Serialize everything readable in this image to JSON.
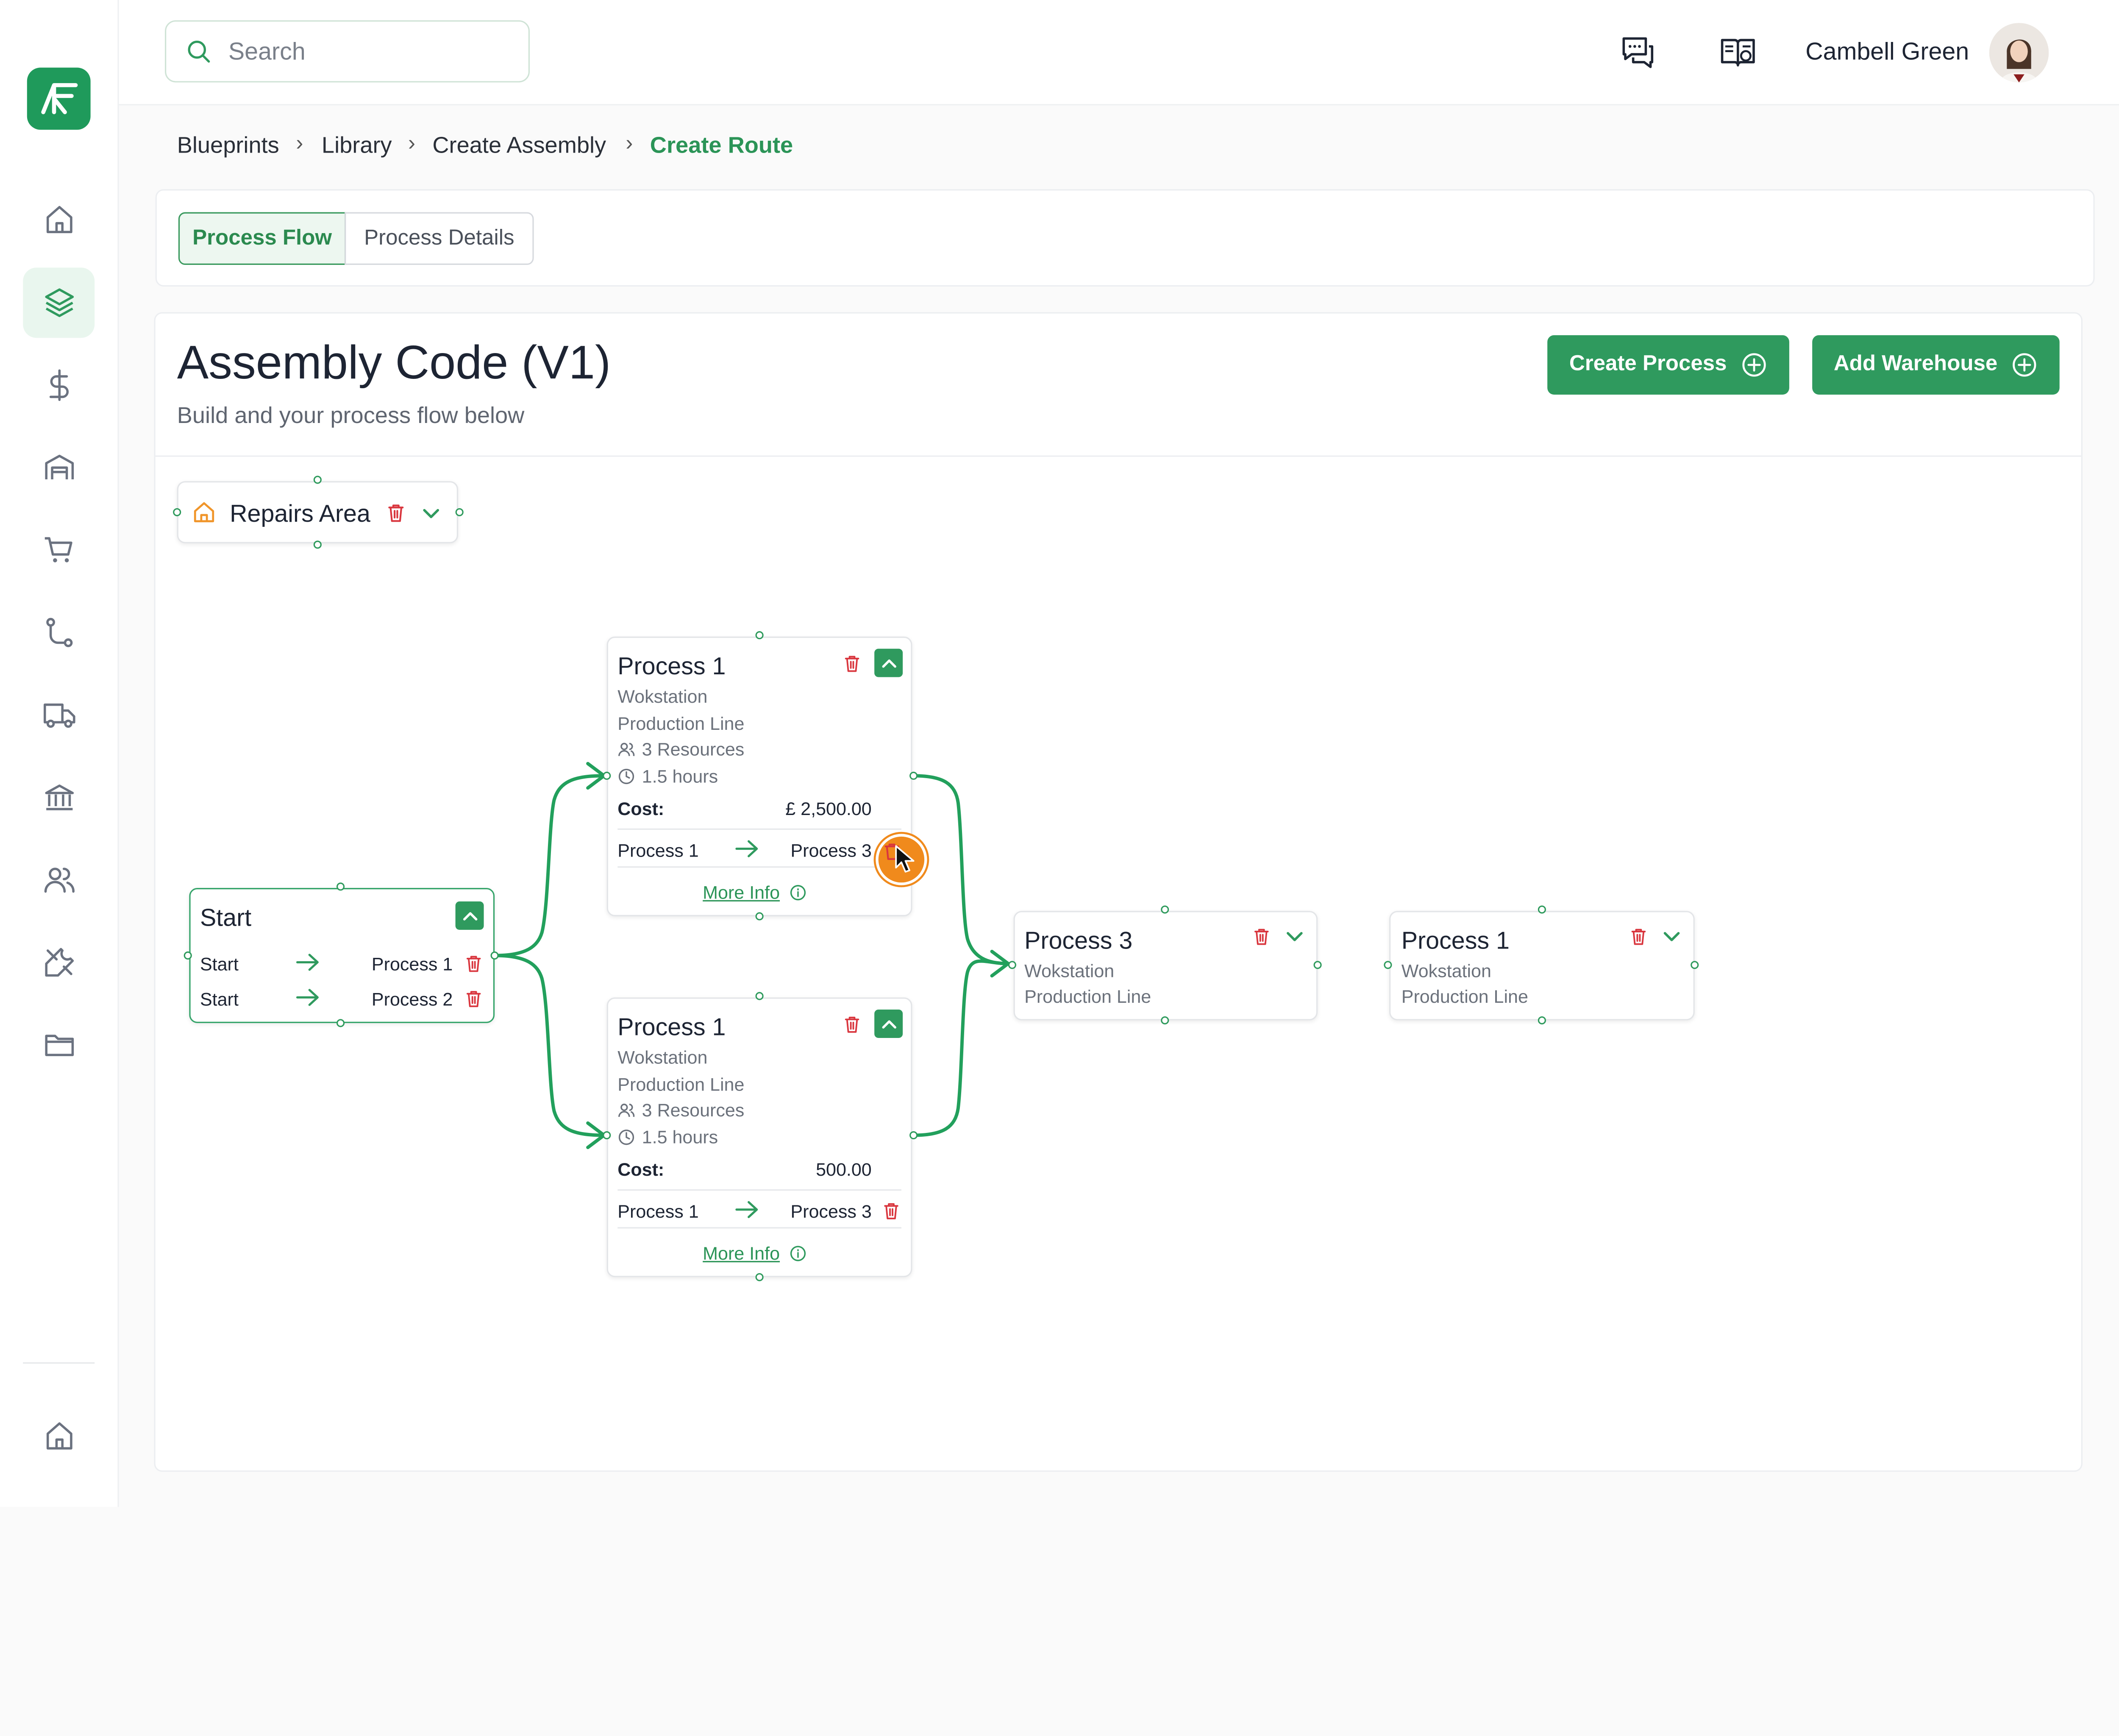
{
  "app": {
    "logo_text": "AF",
    "user_name": "Cambell Green"
  },
  "search": {
    "placeholder": "Search",
    "value": ""
  },
  "sidebar": {
    "items": [
      {
        "icon": "home-icon",
        "active": false
      },
      {
        "icon": "layers-icon",
        "active": true
      },
      {
        "icon": "dollar-icon",
        "active": false
      },
      {
        "icon": "warehouse-icon",
        "active": false
      },
      {
        "icon": "cart-icon",
        "active": false
      },
      {
        "icon": "route-icon",
        "active": false
      },
      {
        "icon": "truck-icon",
        "active": false
      },
      {
        "icon": "bank-icon",
        "active": false
      },
      {
        "icon": "users-icon",
        "active": false
      },
      {
        "icon": "tools-icon",
        "active": false
      },
      {
        "icon": "folder-icon",
        "active": false
      }
    ],
    "bottom_item": {
      "icon": "home-icon"
    }
  },
  "breadcrumb": [
    "Blueprints",
    "Library",
    "Create Assembly",
    "Create Route"
  ],
  "tabs": [
    {
      "label": "Process Flow",
      "active": true
    },
    {
      "label": "Process Details",
      "active": false
    }
  ],
  "main": {
    "title": "Assembly Code (V1)",
    "subtitle": "Build and your process flow below",
    "create_process_label": "Create Process",
    "add_warehouse_label": "Add Warehouse"
  },
  "flow": {
    "repairs": {
      "label": "Repairs Area"
    },
    "start": {
      "title": "Start",
      "links": [
        {
          "from": "Start",
          "to": "Process 1"
        },
        {
          "from": "Start",
          "to": "Process 2"
        }
      ]
    },
    "process_top": {
      "title": "Process 1",
      "workstation": "Wokstation",
      "line": "Production Line",
      "resources": "3 Resources",
      "duration": "1.5 hours",
      "cost_label": "Cost:",
      "cost_value": "£ 2,500.00",
      "link_from": "Process 1",
      "link_to": "Process 3",
      "more_info": "More Info"
    },
    "process_bottom": {
      "title": "Process 1",
      "workstation": "Wokstation",
      "line": "Production Line",
      "resources": "3 Resources",
      "duration": "1.5 hours",
      "cost_label": "Cost:",
      "cost_value": "500.00",
      "link_from": "Process 1",
      "link_to": "Process 3",
      "more_info": "More Info"
    },
    "process_3": {
      "title": "Process 3",
      "workstation": "Wokstation",
      "line": "Production Line"
    },
    "process_1_right": {
      "title": "Process 1",
      "workstation": "Wokstation",
      "line": "Production Line"
    }
  },
  "colors": {
    "accent": "#2f9a5e",
    "active_bg": "#e9f6ee",
    "danger": "#d9363e",
    "warehouse_icon": "#f0952a",
    "cursor_ring": "#f08a1c"
  }
}
